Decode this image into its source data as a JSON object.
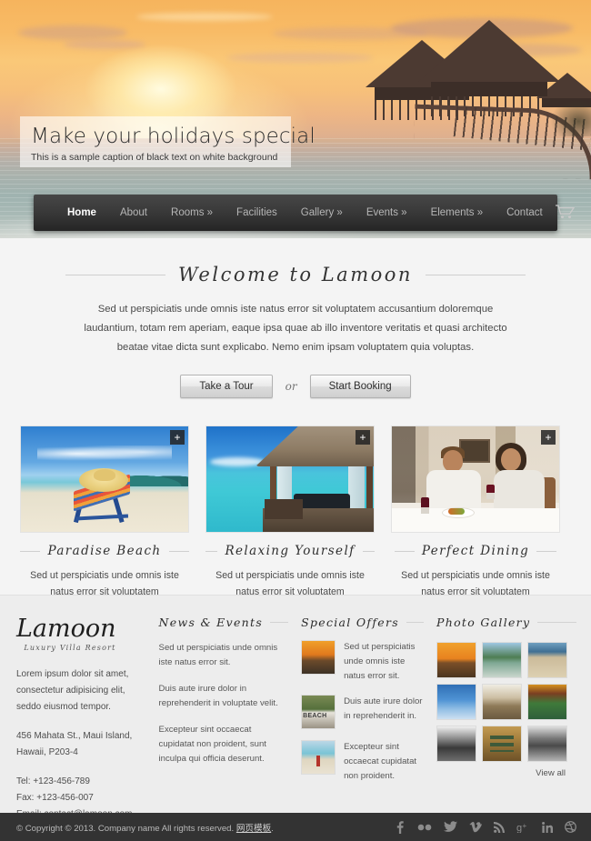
{
  "hero": {
    "title": "Make your holidays special",
    "subtitle": "This is a sample caption of black text on white background",
    "image_alt": "tropical-sunset-overwater-bungalows"
  },
  "nav": {
    "items": [
      {
        "label": "Home",
        "active": true
      },
      {
        "label": "About",
        "active": false
      },
      {
        "label": "Rooms »",
        "active": false
      },
      {
        "label": "Facilities",
        "active": false
      },
      {
        "label": "Gallery »",
        "active": false
      },
      {
        "label": "Events »",
        "active": false
      },
      {
        "label": "Elements »",
        "active": false
      },
      {
        "label": "Contact",
        "active": false
      }
    ],
    "cart_icon": "shopping-cart-icon"
  },
  "welcome": {
    "heading": "Welcome to Lamoon",
    "paragraph": "Sed ut perspiciatis unde omnis iste natus error sit voluptatem accusantium doloremque laudantium, totam rem aperiam, eaque ipsa quae ab illo inventore veritatis et quasi architecto beatae vitae dicta sunt explicabo. Nemo enim ipsam voluptatem quia voluptas.",
    "primary_button": "Take a Tour",
    "separator": "or",
    "secondary_button": "Start Booking"
  },
  "cards": [
    {
      "title": "Paradise Beach",
      "text": "Sed ut perspiciatis unde omnis iste natus error sit voluptatem accusantium.",
      "badge": "+",
      "image_alt": "beach-chair-with-straw-hat"
    },
    {
      "title": "Relaxing Yourself",
      "text": "Sed ut perspiciatis unde omnis iste natus error sit voluptatem accusantium.",
      "badge": "+",
      "image_alt": "thatched-cabana-over-turquoise-water"
    },
    {
      "title": "Perfect Dining",
      "text": "Sed ut perspiciatis unde omnis iste natus error sit voluptatem accusantium.",
      "badge": "+",
      "image_alt": "couple-dining-with-wine"
    }
  ],
  "footer": {
    "logo": "Lamoon",
    "tagline": "Luxury Villa Resort",
    "about": "Lorem ipsum dolor sit amet, consectetur adipisicing elit, seddo eiusmod tempor.",
    "address": "456 Mahata St., Maui Island, Hawaii, P203-4",
    "tel": "Tel: +123-456-789",
    "fax": "Fax: +123-456-007",
    "email": "Email: contact@lamoon.com",
    "news": {
      "heading": "News & Events",
      "items": [
        "Sed ut perspiciatis unde omnis iste natus error sit.",
        "Duis aute irure dolor in reprehenderit in voluptate velit.",
        "Excepteur sint occaecat cupidatat non proident, sunt inculpa qui officia deserunt."
      ]
    },
    "offers": {
      "heading": "Special Offers",
      "items": [
        {
          "text": "Sed ut perspiciatis unde omnis iste natus error sit.",
          "thumb_alt": "sunset-road-thumbnail"
        },
        {
          "text": "Duis aute irure dolor in reprehenderit in.",
          "thumb_alt": "beach-sign-thumbnail"
        },
        {
          "text": "Excepteur sint occaecat cupidatat non proident.",
          "thumb_alt": "shore-kayak-thumbnail"
        }
      ]
    },
    "gallery": {
      "heading": "Photo Gallery",
      "thumbs": [
        "sunset-over-sea",
        "green-hills-lagoon",
        "sandy-beach-shore",
        "blue-sky-clouds",
        "old-boat-sepia",
        "colorful-deck-chairs",
        "mountain-bw",
        "wooden-bench",
        "grayscale-shoreline"
      ],
      "view_all": "View all"
    }
  },
  "bottombar": {
    "copyright_prefix": "© Copyright © 2013. Company name All rights reserved.",
    "cn_link": "网页模板",
    "copyright_suffix": ".",
    "social": [
      {
        "name": "facebook-icon",
        "glyph": "f"
      },
      {
        "name": "flickr-icon",
        "glyph": "••"
      },
      {
        "name": "twitter-icon",
        "glyph": "🐦"
      },
      {
        "name": "vimeo-icon",
        "glyph": "V"
      },
      {
        "name": "rss-icon",
        "glyph": "≫"
      },
      {
        "name": "google-plus-icon",
        "glyph": "g+"
      },
      {
        "name": "linkedin-icon",
        "glyph": "in"
      },
      {
        "name": "dribbble-icon",
        "glyph": "◉"
      }
    ]
  },
  "colors": {
    "nav_bg": "#3a3a3a",
    "page_bg": "#f4f4f4",
    "footer_bg": "#ededed",
    "bottombar_bg": "#333333",
    "accent_text": "#2f2f2f"
  }
}
